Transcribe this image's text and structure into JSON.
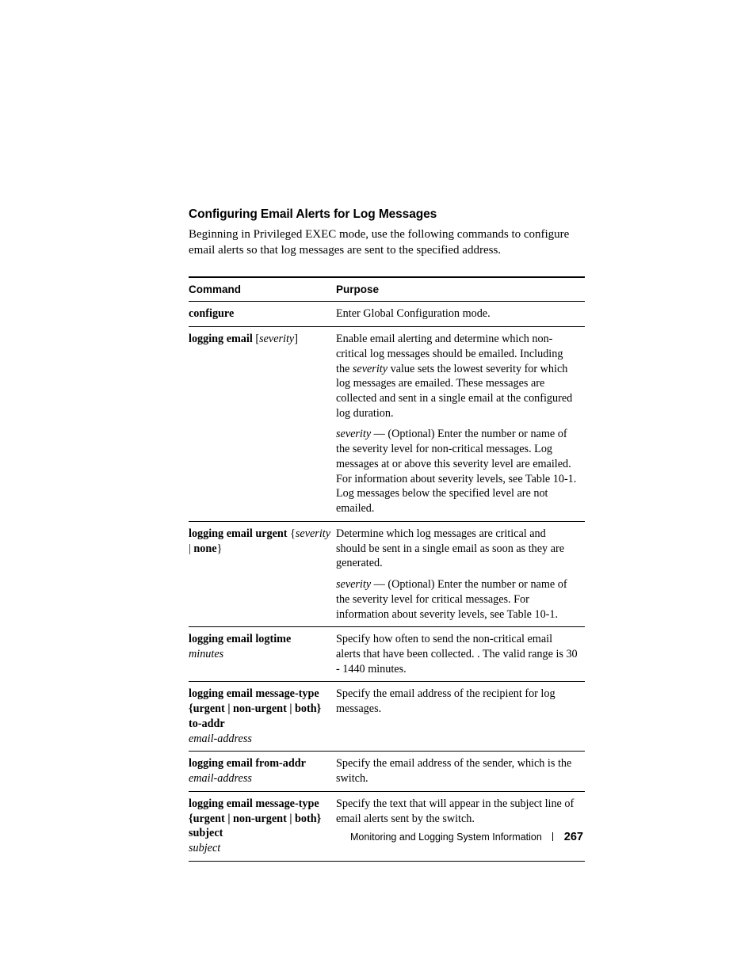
{
  "heading": "Configuring Email Alerts for Log Messages",
  "intro": "Beginning in Privileged EXEC mode, use the following commands to configure email alerts so that log messages are sent to the specified address.",
  "table": {
    "headers": {
      "command": "Command",
      "purpose": "Purpose"
    },
    "rows": {
      "configure": {
        "cmd_bold": "configure",
        "purpose": "Enter Global Configuration mode."
      },
      "logging_email": {
        "cmd_bold_a": "logging email",
        "cmd_open": " [",
        "cmd_ital": "severity",
        "cmd_close": "]",
        "purpose1_a": "Enable email alerting and determine which non-critical log messages should be emailed. Including the ",
        "purpose1_ital": "severity",
        "purpose1_b": " value sets the lowest severity for which log messages are emailed. These messages are collected and sent in a single email at the configured log duration.",
        "purpose2_ital": "severity",
        "purpose2_rest": " — (Optional) Enter the number or name of the severity level for non-critical messages. Log messages at or above this severity level are emailed. For information about severity levels, see Table 10-1. Log messages below the specified level are not emailed."
      },
      "logging_email_urgent": {
        "cmd_bold_a": "logging email urgent",
        "cmd_open": " {",
        "cmd_ital": "severity",
        "cmd_mid": " | ",
        "cmd_bold_b": "none",
        "cmd_close": "}",
        "purpose1": "Determine which log messages are critical and should be sent in a single email as soon as they are generated.",
        "purpose2_ital": "severity",
        "purpose2_rest": " — (Optional) Enter the number or name of the severity level for critical messages. For information about severity levels, see Table 10-1."
      },
      "logging_email_logtime": {
        "cmd_bold": "logging email logtime",
        "cmd_ital": "minutes",
        "purpose": "Specify how often to send the non-critical email alerts that have been collected. . The valid range is 30 - 1440 minutes."
      },
      "logging_email_msgtype_toaddr": {
        "cmd_bold": "logging email message-type {urgent | non-urgent | both} to-addr",
        "cmd_ital": "email-address",
        "purpose": "Specify the email address of the recipient for log messages."
      },
      "logging_email_fromaddr": {
        "cmd_bold": "logging email from-addr",
        "cmd_ital": "email-address",
        "purpose": "Specify the email address of the sender, which is the switch."
      },
      "logging_email_msgtype_subject": {
        "cmd_bold": "logging email message-type {urgent | non-urgent | both} subject",
        "cmd_ital": "subject",
        "purpose": "Specify the text that will appear in the subject line of email alerts sent by the switch."
      }
    }
  },
  "footer": {
    "section": "Monitoring and Logging System Information",
    "page": "267"
  }
}
